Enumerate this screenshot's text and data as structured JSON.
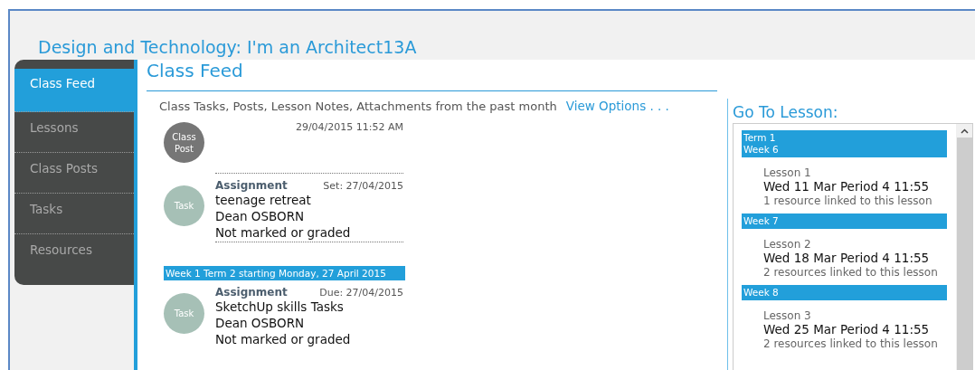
{
  "page_title": "Design and Technology: I'm an Architect13A",
  "sidebar": {
    "items": [
      {
        "label": "Class Feed",
        "selected": true
      },
      {
        "label": "Lessons",
        "selected": false
      },
      {
        "label": "Class Posts",
        "selected": false
      },
      {
        "label": "Tasks",
        "selected": false
      },
      {
        "label": "Resources",
        "selected": false
      }
    ]
  },
  "feed": {
    "heading": "Class Feed",
    "summary": "Class Tasks, Posts, Lesson Notes, Attachments from the past month",
    "view_options": "View Options . . .",
    "entries": [
      {
        "kind": "post",
        "badge": [
          "Class",
          "Post"
        ],
        "date": "29/04/2015 11:52 AM"
      },
      {
        "kind": "task",
        "badge": [
          "Task"
        ],
        "type": "Assignment",
        "date": "Set: 27/04/2015",
        "lines": [
          "teenage retreat",
          "Dean OSBORN",
          "Not marked or graded"
        ]
      },
      {
        "kind": "week",
        "label": "Week 1 Term 2 starting Monday, 27 April 2015"
      },
      {
        "kind": "task",
        "badge": [
          "Task"
        ],
        "type": "Assignment",
        "date": "Due: 27/04/2015",
        "lines": [
          "SketchUp skills Tasks",
          "Dean OSBORN",
          "Not marked or graded"
        ]
      }
    ]
  },
  "go_to_lesson": {
    "heading": "Go To Lesson:",
    "groups": [
      {
        "header": [
          "Term 1",
          "Week 6"
        ],
        "lesson": "Lesson 1",
        "when": "Wed 11 Mar Period 4 11:55",
        "resources": "1 resource linked to this lesson"
      },
      {
        "header": [
          "Week 7"
        ],
        "lesson": "Lesson 2",
        "when": "Wed 18 Mar Period 4 11:55",
        "resources": "2 resources linked to this lesson"
      },
      {
        "header": [
          "Week 8"
        ],
        "lesson": "Lesson 3",
        "when": "Wed 25 Mar Period 4 11:55",
        "resources": "2 resources linked to this lesson"
      }
    ]
  }
}
